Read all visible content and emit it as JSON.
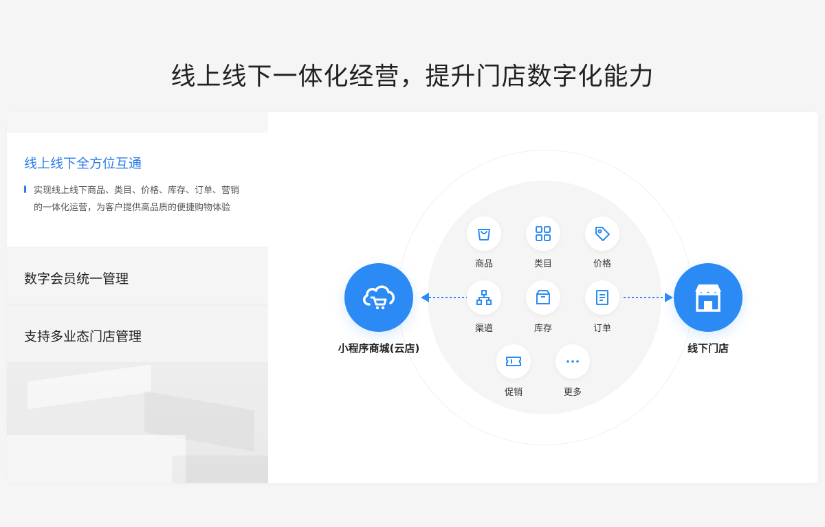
{
  "page_title": "线上线下一体化经营，提升门店数字化能力",
  "features": [
    {
      "title": "线上线下全方位互通",
      "desc": "实现线上线下商品、类目、价格、库存、订单、营销的一体化运营，为客户提供高品质的便捷购物体验"
    },
    {
      "title": "数字会员统一管理"
    },
    {
      "title": "支持多业态门店管理"
    }
  ],
  "diagram": {
    "left_node": "小程序商城(云店)",
    "right_node": "线下门店",
    "items": [
      "商品",
      "类目",
      "价格",
      "渠道",
      "库存",
      "订单",
      "促销",
      "更多"
    ]
  },
  "colors": {
    "accent": "#2b7de9",
    "circle": "#2b8af3"
  }
}
